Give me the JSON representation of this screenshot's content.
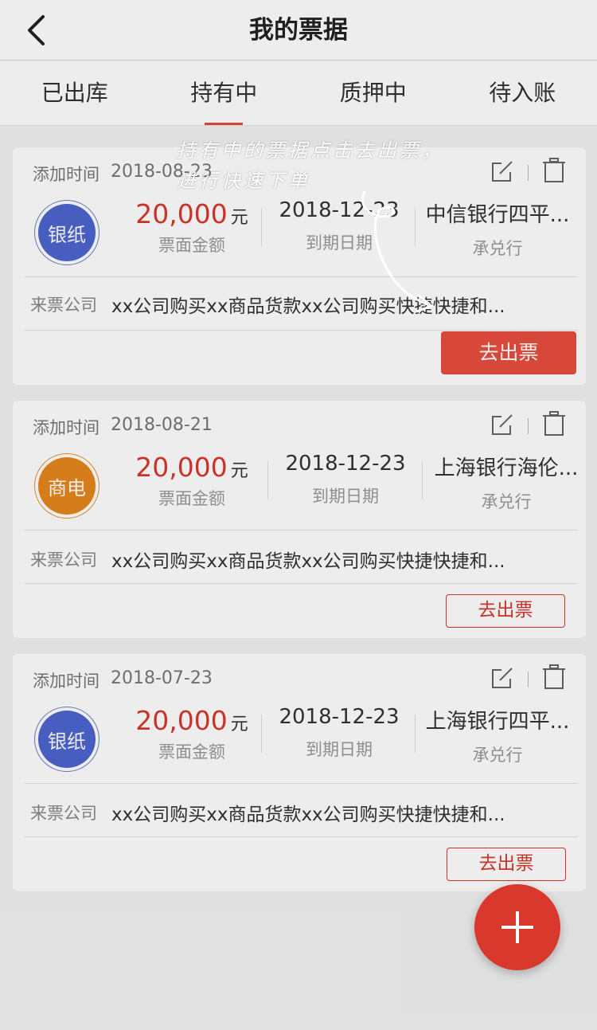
{
  "header": {
    "title": "我的票据"
  },
  "tabs": [
    {
      "label": "已出库"
    },
    {
      "label": "持有中"
    },
    {
      "label": "质押中"
    },
    {
      "label": "待入账"
    }
  ],
  "labels": {
    "added_time": "添加时间",
    "face_amount": "票面金额",
    "due_date": "到期日期",
    "acceptor": "承兑行",
    "source_company": "来票公司",
    "unit": "元",
    "out_button": "去出票"
  },
  "hint": {
    "text": "持有中的票据点击去出票，进行快速下单"
  },
  "cards": [
    {
      "added": "2018-08-23",
      "type": "银纸",
      "type_color": "#4d66cf",
      "amount": "20,000",
      "due": "2018-12-23",
      "bank": "中信银行四平...",
      "company": "xx公司购买xx商品货款xx公司购买快捷快捷和..."
    },
    {
      "added": "2018-08-21",
      "type": "商电",
      "type_color": "#e6871d",
      "amount": "20,000",
      "due": "2018-12-23",
      "bank": "上海银行海伦...",
      "company": "xx公司购买xx商品货款xx公司购买快捷快捷和..."
    },
    {
      "added": "2018-07-23",
      "type": "银纸",
      "type_color": "#4d66cf",
      "amount": "20,000",
      "due": "2018-12-23",
      "bank": "上海银行四平...",
      "company": "xx公司购买xx商品货款xx公司购买快捷快捷和..."
    }
  ],
  "icons": {
    "back": "chevron-left-icon",
    "edit": "edit-icon",
    "delete": "trash-icon",
    "add": "plus-icon"
  },
  "colors": {
    "accent": "#e84e40",
    "amount": "#d9362b"
  }
}
